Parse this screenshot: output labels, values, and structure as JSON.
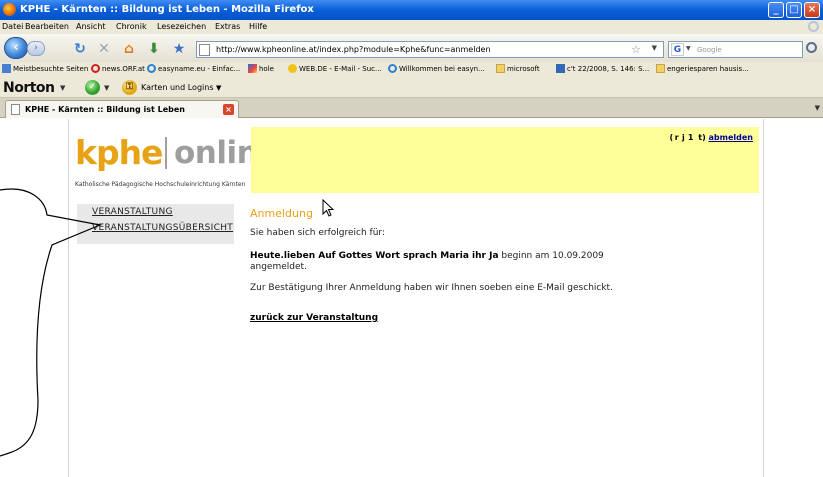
{
  "window": {
    "title": "KPHE - Kärnten :: Bildung ist Leben - Mozilla Firefox",
    "buttons": {
      "minimize": "_",
      "maximize": "□",
      "close": "×"
    }
  },
  "menu": [
    "Datei",
    "Bearbeiten",
    "Ansicht",
    "Chronik",
    "Lesezeichen",
    "Extras",
    "Hilfe"
  ],
  "navigation": {
    "back_glyph": "‹",
    "forward_glyph": "›",
    "url": "http://www.kpheonline.at/index.php?module=Kphe&func=anmelden",
    "search_placeholder": "Google",
    "search_engine_glyph": "G"
  },
  "bookmarks": [
    "Meistbesuchte Seiten",
    "news.ORF.at",
    "easyname.eu - Einfac...",
    "hole",
    "WEB.DE - E-Mail - Suc...",
    "Willkommen bei easyn...",
    "microsoft",
    "c't 22/2008, S. 146: S...",
    "engeriesparen hausis..."
  ],
  "norton": {
    "brand": "Norton",
    "check_glyph": "✓",
    "key_glyph": "⚿",
    "cards_label": "Karten und Logins"
  },
  "tab": {
    "title": "KPHE - Kärnten :: Bildung ist Leben",
    "close_glyph": "×"
  },
  "site": {
    "logo_kphe": "kphe",
    "logo_online": "online",
    "logo_subtitle": "Katholische Pädagogische Hochschuleinrichtung Kärnten",
    "user_name": "( r  j  1   t)",
    "logout_label": "abmelden",
    "sidenav": [
      "VERANSTALTUNG",
      "VERANSTALTUNGSÜBERSICHT"
    ]
  },
  "main": {
    "title": "Anmeldung",
    "success_text": "Sie haben sich erfolgreich für:",
    "event_name": "Heute.lieben Auf Gottes Wort sprach Maria ihr Ja",
    "event_start": " beginn am 10.09.2009",
    "registered": "angemeldet.",
    "confirmation": "Zur Bestätigung Ihrer Anmeldung haben wir Ihnen soeben eine E-Mail geschickt.",
    "back_link": "zurück zur Veranstaltung"
  },
  "colors": {
    "accent_orange": "#e8a216",
    "header_yellow": "#ffff99",
    "link_blue": "#000099",
    "titlebar_blue": "#0a5fd8"
  }
}
